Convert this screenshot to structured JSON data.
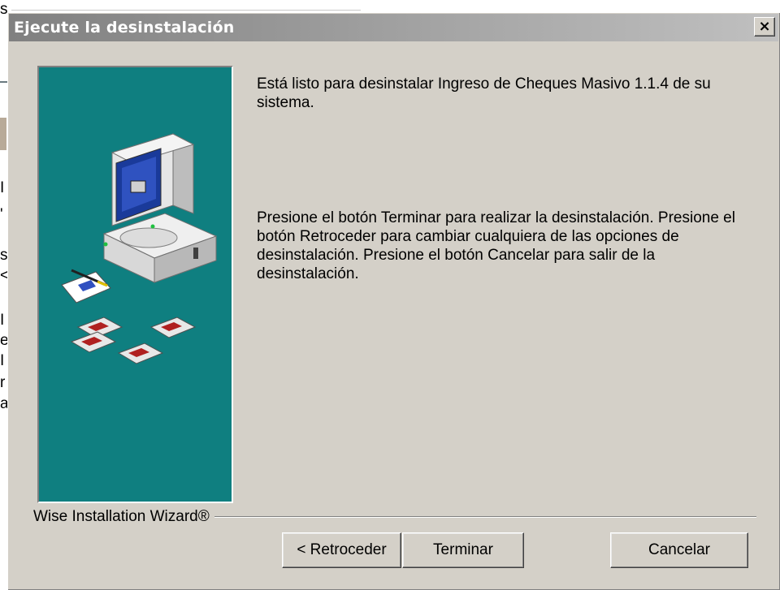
{
  "background": {
    "fragments": [
      "s",
      "I",
      "'",
      "s",
      "<",
      "I",
      "e",
      "I",
      "r",
      "a"
    ]
  },
  "dialog": {
    "title": "Ejecute la desinstalación",
    "close_glyph": "×",
    "message_1": "Está listo para desinstalar Ingreso de Cheques Masivo 1.1.4 de su sistema.",
    "message_2": "Presione el botón Terminar para realizar la desinstalación. Presione el botón Retroceder para cambiar cualquiera de las opciones de desinstalación. Presione el botón Cancelar para salir de la desinstalación.",
    "brand": "Wise Installation Wizard®",
    "buttons": {
      "back": "< Retroceder",
      "finish": "Terminar",
      "cancel": "Cancelar"
    }
  },
  "colors": {
    "panel_teal": "#0f7f80",
    "dialog_face": "#d4d0c8",
    "titlebar_inactive": "#808080"
  },
  "icons": {
    "graphic": "computer-with-disks-illustration",
    "close": "close-icon"
  }
}
